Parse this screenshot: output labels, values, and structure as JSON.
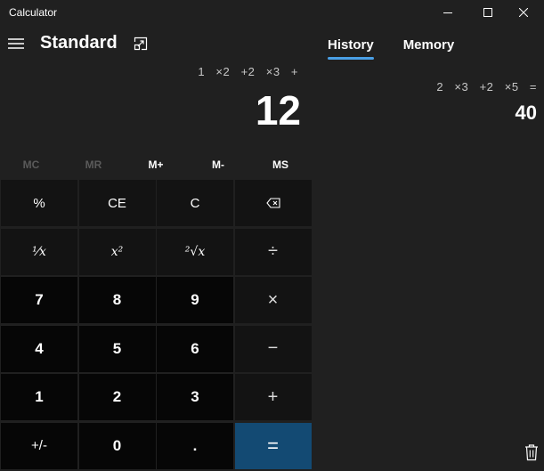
{
  "window": {
    "title": "Calculator",
    "controls": [
      "minimize-icon",
      "maximize-icon",
      "close-icon"
    ]
  },
  "header": {
    "menu_icon": "hamburger-icon",
    "mode": "Standard",
    "keep_on_top_icon": "keep-on-top-icon"
  },
  "display": {
    "expression": "1   ×2   +2   ×3   +",
    "value": "12"
  },
  "memory_buttons": [
    {
      "label": "MC",
      "enabled": false
    },
    {
      "label": "MR",
      "enabled": false
    },
    {
      "label": "M+",
      "enabled": true
    },
    {
      "label": "M-",
      "enabled": true
    },
    {
      "label": "MS",
      "enabled": true
    }
  ],
  "keys": {
    "percent": "%",
    "clear_entry": "CE",
    "clear": "C",
    "backspace_icon": "backspace-icon",
    "reciprocal": "¹⁄x",
    "square": "x²",
    "sqrt": "²√x",
    "divide": "÷",
    "seven": "7",
    "eight": "8",
    "nine": "9",
    "multiply": "×",
    "four": "4",
    "five": "5",
    "six": "6",
    "minus": "−",
    "one": "1",
    "two": "2",
    "three": "3",
    "plus": "+",
    "negate": "+/-",
    "zero": "0",
    "decimal": ".",
    "equals": "="
  },
  "panel": {
    "tabs": [
      "History",
      "Memory"
    ],
    "active_tab": "History",
    "history": [
      {
        "expression": "2   ×3   +2   ×5   =",
        "result": "40"
      }
    ],
    "delete_icon": "trash-icon"
  },
  "colors": {
    "background": "#202020",
    "key_function": "#131313",
    "key_number": "#060606",
    "equals_accent": "#134a73",
    "tab_underline": "#4aa0e6"
  }
}
